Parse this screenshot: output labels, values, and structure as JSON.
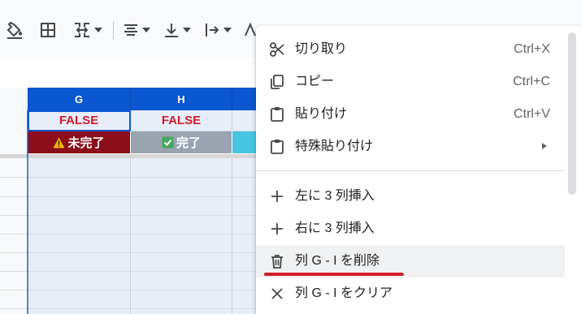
{
  "toolbar": {
    "icons": [
      "fill-color-icon",
      "borders-icon",
      "merge-cells-icon",
      "horizontal-align-icon",
      "vertical-align-icon",
      "text-wrapping-icon",
      "text-rotation-icon"
    ]
  },
  "columns": {
    "headers": [
      "G",
      "H"
    ]
  },
  "cells": {
    "g_value": "FALSE",
    "h_value": "FALSE",
    "g_status": "未完了",
    "h_status": "完了"
  },
  "colors": {
    "header_blue": "#0b57d0",
    "status_incomplete_bg": "#8b0e1a",
    "status_complete_bg": "#9aa4b0",
    "status_cyan": "#46c5e0",
    "false_text": "#d01a2a",
    "underline": "#d31f26"
  },
  "context_menu": {
    "items": [
      {
        "label": "切り取り",
        "shortcut": "Ctrl+X",
        "icon": "scissors-icon"
      },
      {
        "label": "コピー",
        "shortcut": "Ctrl+C",
        "icon": "copy-icon"
      },
      {
        "label": "貼り付け",
        "shortcut": "Ctrl+V",
        "icon": "clipboard-icon"
      },
      {
        "label": "特殊貼り付け",
        "shortcut": "",
        "icon": "clipboard-icon"
      },
      {
        "label": "左に 3 列挿入",
        "shortcut": "",
        "icon": "plus-icon"
      },
      {
        "label": "右に 3 列挿入",
        "shortcut": "",
        "icon": "plus-icon"
      },
      {
        "label": "列 G - I を削除",
        "shortcut": "",
        "icon": "trash-icon"
      },
      {
        "label": "列 G - I をクリア",
        "shortcut": "",
        "icon": "close-icon"
      }
    ]
  }
}
